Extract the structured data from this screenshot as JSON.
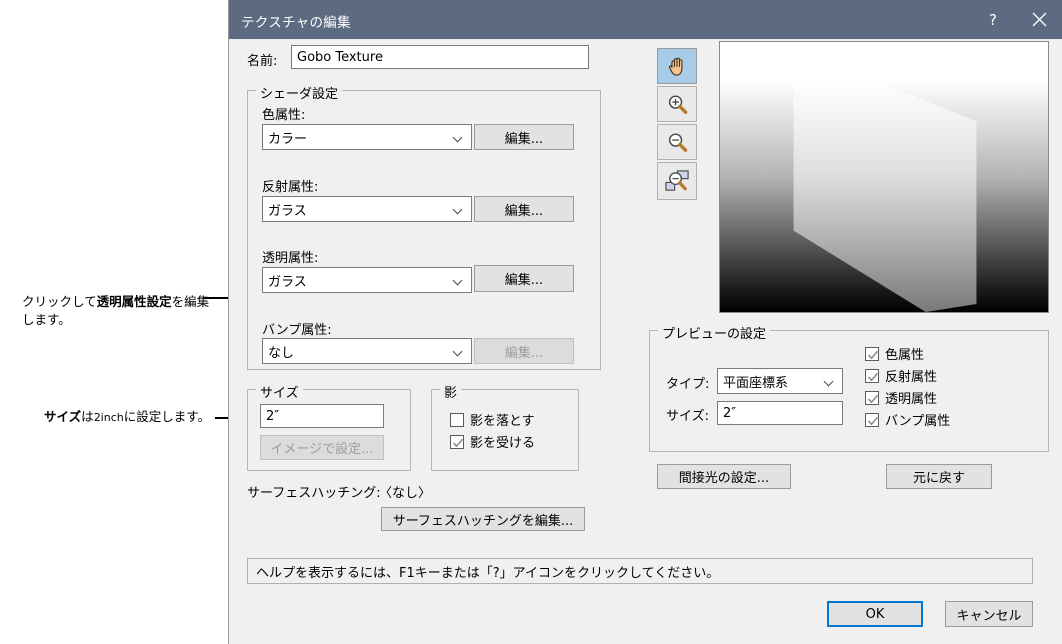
{
  "annotations": [
    {
      "id": "transparency",
      "text_parts": [
        "クリックして",
        "透明属性設定",
        "を編集",
        "します。"
      ]
    },
    {
      "id": "size",
      "text_parts": [
        "サイズ",
        "は",
        "2inch",
        "に設定します。"
      ]
    }
  ],
  "annotation_1": {
    "lead": "クリックして",
    "bold": "透明属性設定",
    "tail": "を編集",
    "line2": "します。"
  },
  "annotation_2": {
    "bold": "サイズ",
    "mid": "は",
    "small": "2inch",
    "tail": "に設定します。"
  },
  "titlebar": {
    "title": "テクスチャの編集",
    "help_label": "?",
    "close_label": "×"
  },
  "name_row": {
    "label": "名前:",
    "value": "Gobo Texture",
    "placeholder": ""
  },
  "shader_group": {
    "title": "シェーダ設定",
    "rows": [
      {
        "label": "色属性:",
        "value": "カラー",
        "button": "編集...",
        "disabled": false
      },
      {
        "label": "反射属性:",
        "value": "ガラス",
        "button": "編集...",
        "disabled": false
      },
      {
        "label": "透明属性:",
        "value": "ガラス",
        "button": "編集...",
        "disabled": false
      },
      {
        "label": "バンプ属性:",
        "value": "なし",
        "button": "編集...",
        "disabled": true
      }
    ]
  },
  "size_group": {
    "title": "サイズ",
    "value": "2″",
    "image_button": "イメージで設定..."
  },
  "shadow_group": {
    "title": "影",
    "items": [
      {
        "label": "影を落とす",
        "checked": false
      },
      {
        "label": "影を受ける",
        "checked": true
      }
    ]
  },
  "surface_hatching": {
    "label": "サーフェスハッチング:",
    "value": "〈なし〉",
    "button": "サーフェスハッチングを編集..."
  },
  "toolbar": {
    "tools": [
      {
        "name": "pan-hand-tool",
        "active": true
      },
      {
        "name": "zoom-in-tool",
        "active": false
      },
      {
        "name": "zoom-out-tool",
        "active": false
      },
      {
        "name": "zoom-fit-tool",
        "active": false
      }
    ]
  },
  "preview_group": {
    "title": "プレビューの設定",
    "type_label": "タイプ:",
    "type_value": "平面座標系",
    "size_label": "サイズ:",
    "size_value": "2″",
    "checks": [
      {
        "label": "色属性",
        "checked": true
      },
      {
        "label": "反射属性",
        "checked": true
      },
      {
        "label": "透明属性",
        "checked": true
      },
      {
        "label": "バンプ属性",
        "checked": true
      }
    ]
  },
  "right_buttons": {
    "indirect_light": "間接光の設定...",
    "revert": "元に戻す"
  },
  "statusbar": {
    "text": "ヘルプを表示するには、F1キーまたは「?」アイコンをクリックしてください。"
  },
  "footer": {
    "ok": "OK",
    "cancel": "キャンセル"
  },
  "colors": {
    "titlebar": "#5d6b82",
    "dialog_bg": "#f0f0f0",
    "accent": "#0078d7",
    "tool_active": "#a8cbe8"
  }
}
